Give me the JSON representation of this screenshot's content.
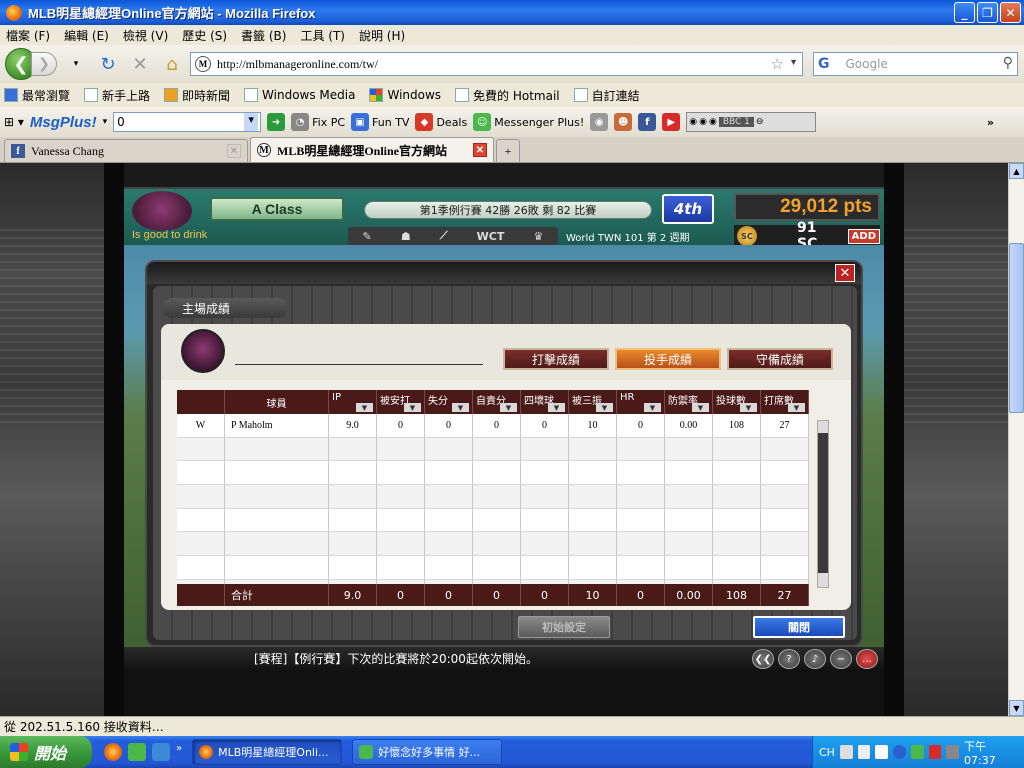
{
  "window": {
    "title": "MLB明星總經理Online官方網站 - Mozilla Firefox"
  },
  "menu": [
    "檔案 (F)",
    "編輯 (E)",
    "檢視 (V)",
    "歷史 (S)",
    "書籤 (B)",
    "工具 (T)",
    "說明 (H)"
  ],
  "nav": {
    "url": "http://mlbmanageronline.com/tw/",
    "search_placeholder": "Google"
  },
  "bookmarks": [
    "最常瀏覽",
    "新手上路",
    "即時新聞",
    "Windows Media",
    "Windows",
    "免費的 Hotmail",
    "自訂連結"
  ],
  "toolbar": {
    "msgplus": "MsgPlus!",
    "combo_value": "0",
    "items": [
      "Fix PC",
      "Fun TV",
      "Deals",
      "Messenger Plus!"
    ],
    "radio_station": "BBC 1",
    "more": "»"
  },
  "tabs": [
    {
      "label": "Vanessa Chang",
      "active": false
    },
    {
      "label": "MLB明星總經理Online官方網站",
      "active": true
    }
  ],
  "game": {
    "class_label": "A Class",
    "season": "第1季例行賽  42勝 26敗  剩 82 比賽",
    "rank": "4th",
    "points": "29,012 pts",
    "tagline": "Is good to drink",
    "icon_strip": [
      "WCT"
    ],
    "week": "World TWN 101 第 2 週期",
    "sc_value": "91 SC",
    "add_label": "ADD",
    "ticker": "[賽程]【例行賽】下次的比賽將於20:00起依次開始。"
  },
  "dialog": {
    "section_title": "主場成績",
    "tabs": [
      {
        "label": "打擊成績",
        "selected": false
      },
      {
        "label": "投手成績",
        "selected": true
      },
      {
        "label": "守備成績",
        "selected": false
      }
    ],
    "columns": [
      "球員",
      "IP",
      "被安打",
      "失分",
      "自責分",
      "四壞球",
      "被三振",
      "HR",
      "防禦率",
      "投球數",
      "打席數"
    ],
    "rows": [
      {
        "role": "W",
        "name": "P Maholm",
        "values": [
          "9.0",
          "0",
          "0",
          "0",
          "0",
          "10",
          "0",
          "0.00",
          "108",
          "27"
        ]
      }
    ],
    "total_label": "合計",
    "totals": [
      "9.0",
      "0",
      "0",
      "0",
      "0",
      "10",
      "0",
      "0.00",
      "108",
      "27"
    ],
    "reset_button": "初始設定",
    "close_button": "關閉"
  },
  "statusbar": "從 202.51.5.160 接收資料…",
  "taskbar": {
    "start": "開始",
    "windows": [
      {
        "label": "MLB明星總經理Onli...",
        "active": true
      },
      {
        "label": "好懷念好多事情  好...",
        "active": false
      }
    ],
    "lang": "CH",
    "clock": "下午 07:37"
  }
}
